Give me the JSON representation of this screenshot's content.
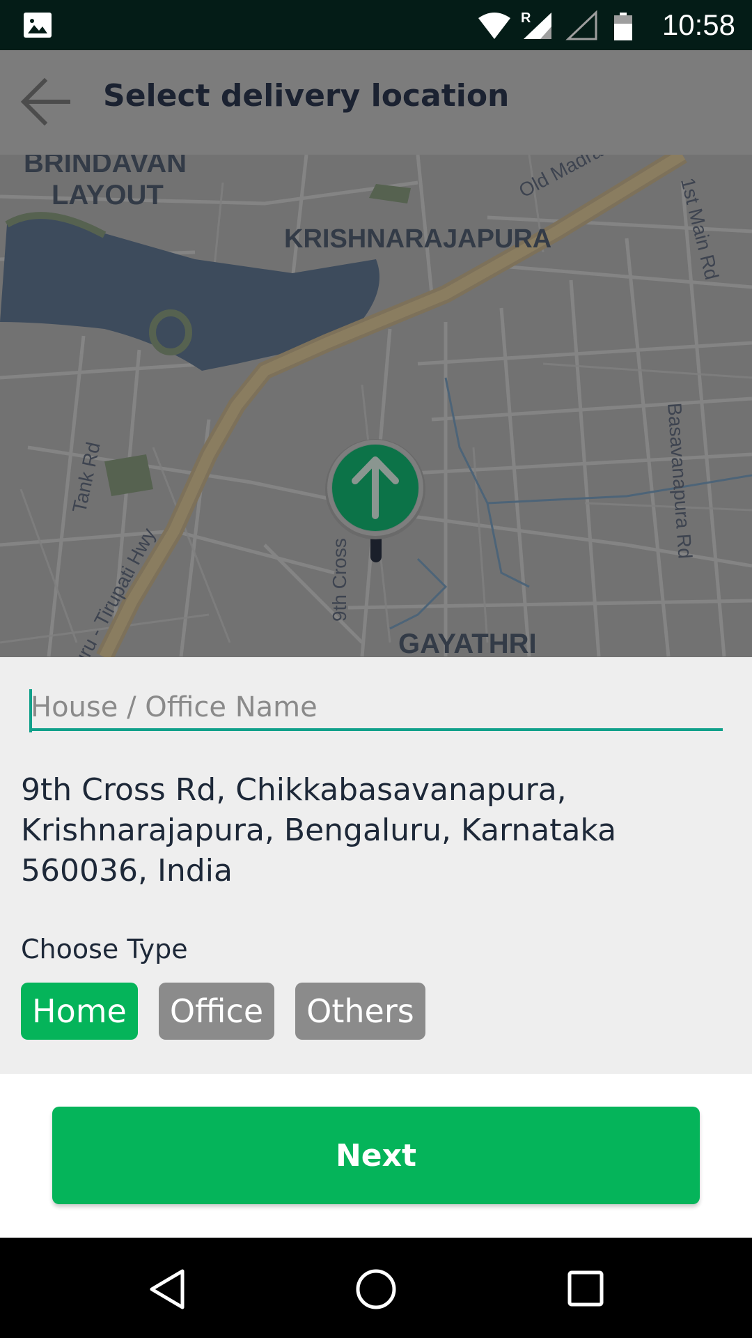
{
  "status_bar": {
    "time": "10:58",
    "icons": [
      "gallery-icon",
      "wifi-icon",
      "signal-roaming-icon",
      "signal-icon",
      "battery-icon"
    ]
  },
  "app_bar": {
    "title": "Select delivery location",
    "back_icon": "arrow-back-icon"
  },
  "map": {
    "labels": {
      "brindavan": "BRINDAVAN",
      "layout": "LAYOUT",
      "krishnarajapura": "KRISHNARAJAPURA",
      "gayathri": "GAYATHRI",
      "old_madras_rd": "Old Madras Rd",
      "first_main_rd": "1st Main Rd",
      "tank_rd": "Tank Rd",
      "tirupati_hwy": "luru - Tirupati Hwy",
      "ninth_cross": "9th Cross",
      "basavanapura_rd": "Basavanapura Rd"
    },
    "pin_icon": "location-pin-arrow-icon"
  },
  "form": {
    "name_placeholder": "House / Office Name",
    "name_value": "",
    "address": "9th Cross Rd, Chikkabasavanapura, Krishnarajapura, Bengaluru, Karnataka 560036, India",
    "choose_type_label": "Choose Type",
    "types": [
      {
        "label": "Home",
        "selected": true
      },
      {
        "label": "Office",
        "selected": false
      },
      {
        "label": "Others",
        "selected": false
      }
    ]
  },
  "next_button": "Next",
  "colors": {
    "accent_green": "#05b45a",
    "underline_teal": "#10a08a",
    "chip_inactive": "#8b8b8b"
  },
  "nav_bar": {
    "icons": [
      "nav-back-icon",
      "nav-home-icon",
      "nav-recents-icon"
    ]
  }
}
